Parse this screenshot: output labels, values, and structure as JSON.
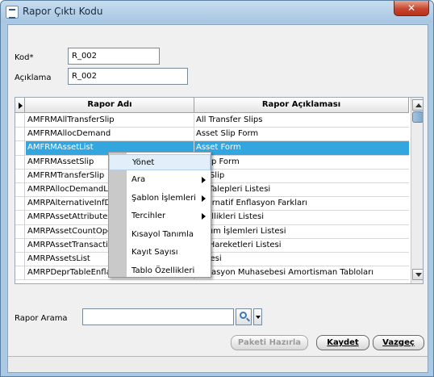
{
  "window": {
    "title": "Rapor Çıktı Kodu",
    "close_label": "✕"
  },
  "form": {
    "kod_label": "Kod*",
    "kod_value": "R_002",
    "aciklama_label": "Açıklama",
    "aciklama_value": "R_002"
  },
  "grid": {
    "columns": [
      "Rapor Adı",
      "Rapor Açıklaması"
    ],
    "rows": [
      [
        "AMFRMAllTransferSlip",
        "All Transfer Slips"
      ],
      [
        "AMFRMAllocDemand",
        "Asset Slip Form"
      ],
      [
        "AMFRMAssetList",
        "Asset Form"
      ],
      [
        "AMFRMAssetSlip",
        "t Slip Form"
      ],
      [
        "AMFRMTransferSlip",
        "fer Slip"
      ],
      [
        "AMRPAllocDemandLis",
        "ım Talepleri Listesi"
      ],
      [
        "AMRPAlternativeInfD",
        "Alternatif Enflasyon Farkları"
      ],
      [
        "AMRPAssetAttributes",
        "Özellikleri Listesi"
      ],
      [
        "AMRPAssetCountOpe",
        "Sayım İşlemleri Listesi"
      ],
      [
        "AMRPAssetTransactio",
        "ım Hareketleri Listesi"
      ],
      [
        "AMRPAssetsList",
        "Listesi"
      ],
      [
        "AMRPDeprTableEnflationParams",
        "Enflasyon Muhasebesi Amortisman Tabloları"
      ]
    ],
    "selected_row": 2
  },
  "context_menu": {
    "items": [
      {
        "label": "Yönet",
        "submenu": false
      },
      {
        "label": "Ara",
        "submenu": true
      },
      {
        "label": "Şablon İşlemleri",
        "submenu": true
      },
      {
        "label": "Tercihler",
        "submenu": true
      },
      {
        "label": "Kısayol Tanımla",
        "submenu": false
      },
      {
        "label": "Kayıt Sayısı",
        "submenu": false
      },
      {
        "label": "Tablo Özellikleri",
        "submenu": false
      }
    ]
  },
  "search": {
    "label": "Rapor Arama",
    "value": ""
  },
  "buttons": {
    "paketi": "Paketi Hazırla",
    "kaydet": "Kaydet",
    "vazgec": "Vazgeç"
  },
  "colors": {
    "selection": "#33a6e0",
    "titlebar": "#a9c9e4",
    "close": "#c74530"
  }
}
